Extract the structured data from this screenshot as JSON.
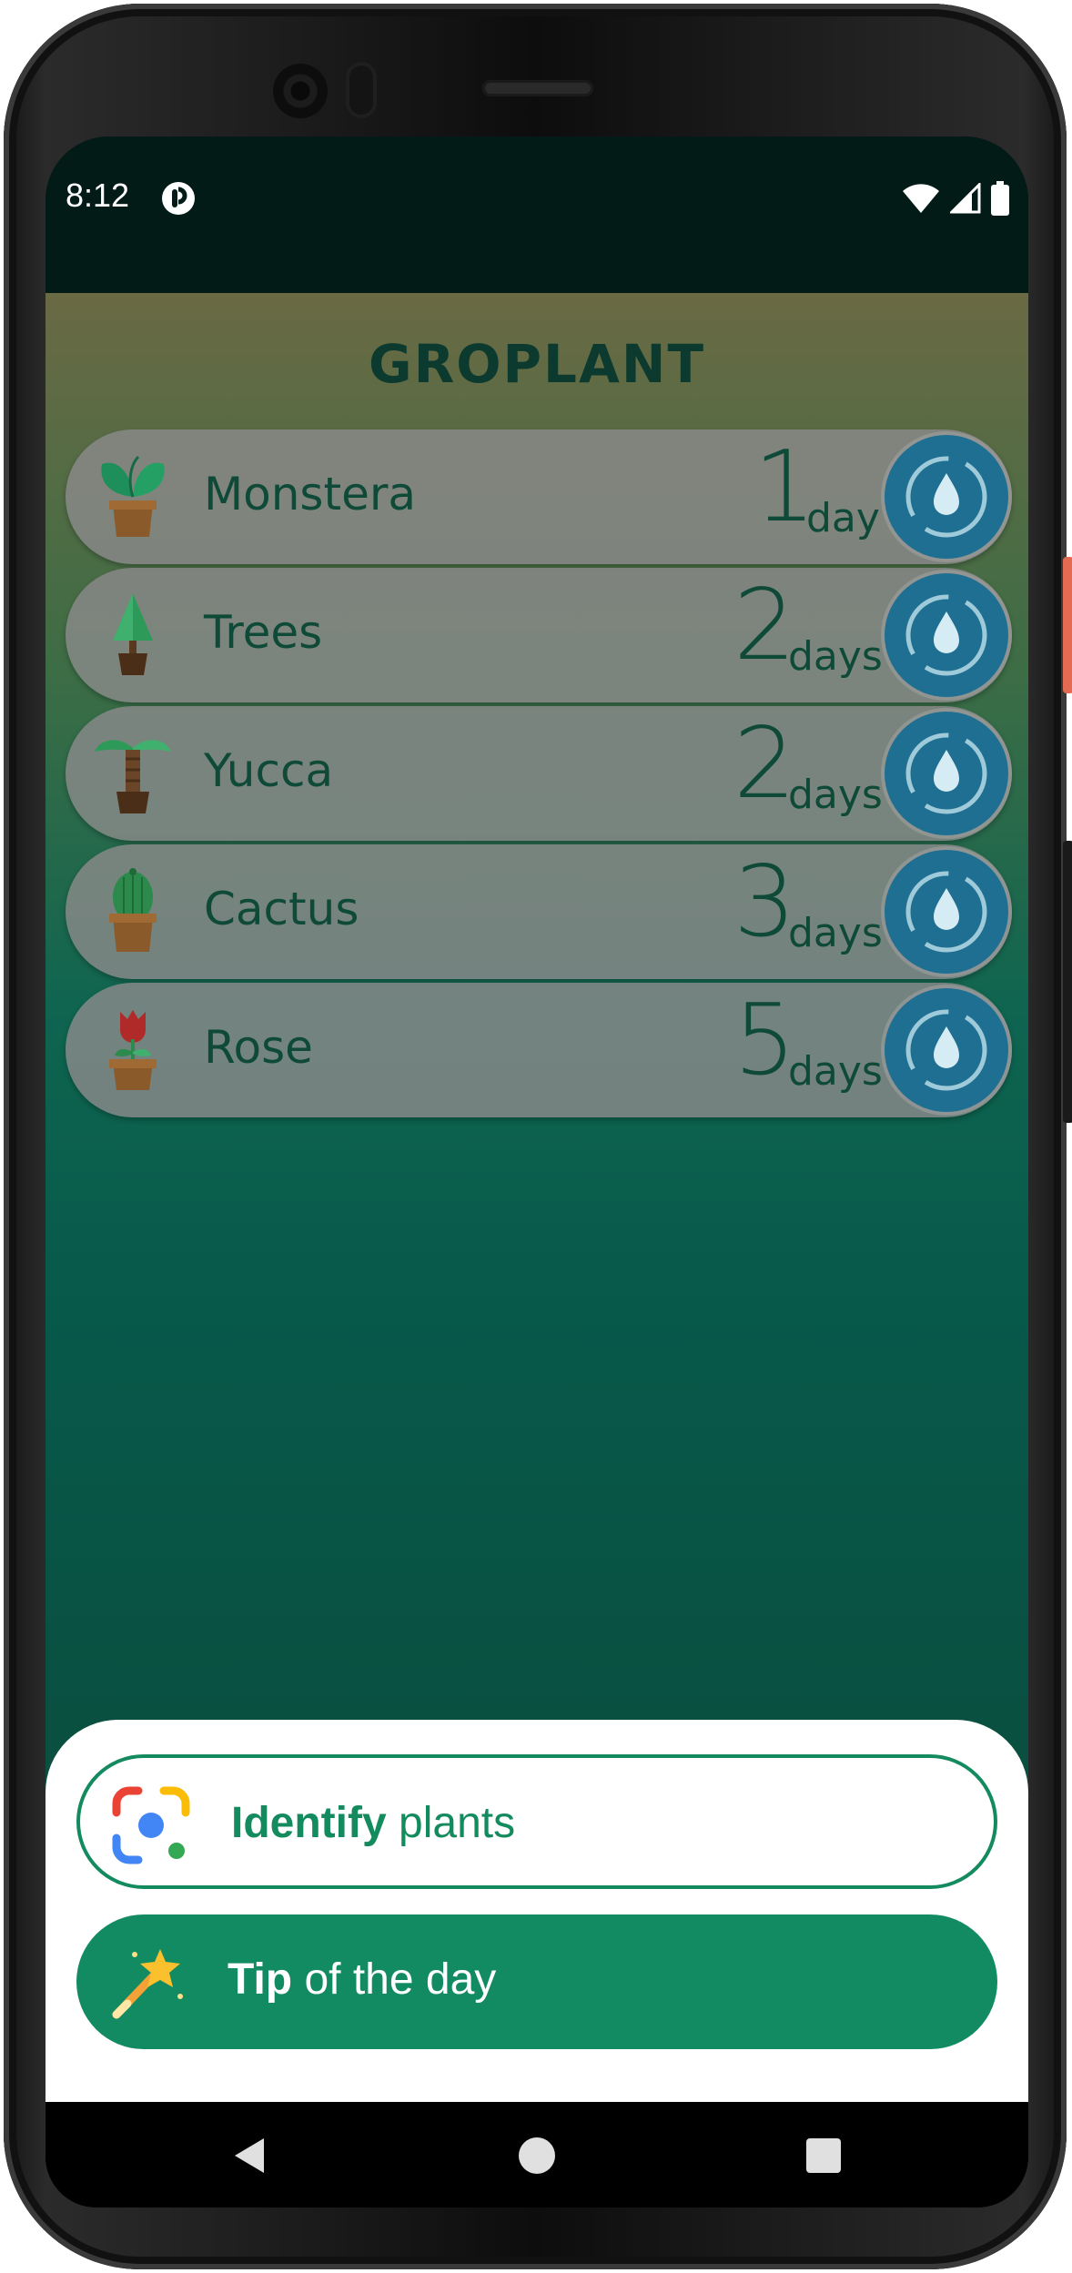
{
  "status_bar": {
    "time": "8:12",
    "app_icon": "app-notification-icon",
    "icons": [
      "wifi-icon",
      "signal-icon",
      "battery-icon"
    ]
  },
  "app": {
    "title": "GROPLANT",
    "plants": [
      {
        "name": "Monstera",
        "count": "1",
        "unit": "day",
        "icon": "monstera-plant-icon"
      },
      {
        "name": "Trees",
        "count": "2",
        "unit": "days",
        "icon": "tree-plant-icon"
      },
      {
        "name": "Yucca",
        "count": "2",
        "unit": "days",
        "icon": "yucca-plant-icon"
      },
      {
        "name": "Cactus",
        "count": "3",
        "unit": "days",
        "icon": "cactus-plant-icon"
      },
      {
        "name": "Rose",
        "count": "5",
        "unit": "days",
        "icon": "rose-plant-icon"
      }
    ],
    "water_button_icon": "water-drop-refresh-icon"
  },
  "actions": {
    "identify": {
      "bold": "Identify",
      "rest": " plants",
      "icon": "google-lens-icon"
    },
    "tip": {
      "bold": "Tip",
      "rest": " of the day",
      "icon": "magic-wand-icon"
    }
  },
  "colors": {
    "brand_green": "#138b62",
    "title_color": "#0d3a2e",
    "water_blue": "#1f6f92",
    "row_gray": "#8a8a8a"
  },
  "navigation": [
    "back-icon",
    "home-icon",
    "recents-icon"
  ]
}
